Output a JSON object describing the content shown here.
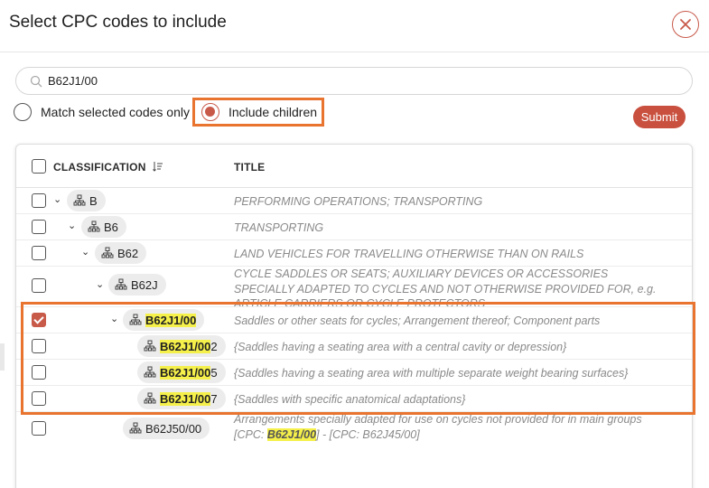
{
  "dialog": {
    "title": "Select CPC codes to include"
  },
  "search": {
    "value": "B62J1/00"
  },
  "options": {
    "match_label": "Match selected codes only",
    "include_label": "Include children",
    "selected": "include"
  },
  "submit_label": "Submit",
  "table": {
    "headers": {
      "classification": "CLASSIFICATION",
      "title": "TITLE"
    },
    "rows": [
      {
        "code": "B",
        "title": "PERFORMING OPERATIONS; TRANSPORTING",
        "checked": false
      },
      {
        "code": "B6",
        "title": "TRANSPORTING",
        "checked": false
      },
      {
        "code": "B62",
        "title": "LAND VEHICLES FOR TRAVELLING OTHERWISE THAN ON RAILS",
        "checked": false
      },
      {
        "code": "B62J",
        "title": "CYCLE SADDLES OR SEATS; AUXILIARY DEVICES OR ACCESSORIES SPECIALLY ADAPTED TO CYCLES AND NOT OTHERWISE PROVIDED FOR, e.g. ARTICLE CARRIERS OR CYCLE PROTECTORS",
        "checked": false
      },
      {
        "code_hl": "B62J1/00",
        "title": "Saddles or other seats for cycles; Arrangement thereof; Component parts",
        "checked": true
      },
      {
        "code_hl": "B62J1/00",
        "code_suffix": "2",
        "title": "{Saddles having a seating area with a central cavity or depression}",
        "checked": false
      },
      {
        "code_hl": "B62J1/00",
        "code_suffix": "5",
        "title": "{Saddles having a seating area with multiple separate weight bearing surfaces}",
        "checked": false
      },
      {
        "code_hl": "B62J1/00",
        "code_suffix": "7",
        "title": "{Saddles with specific anatomical adaptations}",
        "checked": false
      },
      {
        "code": "B62J50/00",
        "title_pre": "Arrangements specially adapted for use on cycles not provided for in main groups [CPC: ",
        "title_hl": "B62J1/00",
        "title_post": "] - [CPC: B62J45/00]",
        "checked": false
      }
    ]
  },
  "colors": {
    "accent": "#c85a4a",
    "highlight_border": "#e8742f",
    "match_highlight": "#f5f04a"
  }
}
